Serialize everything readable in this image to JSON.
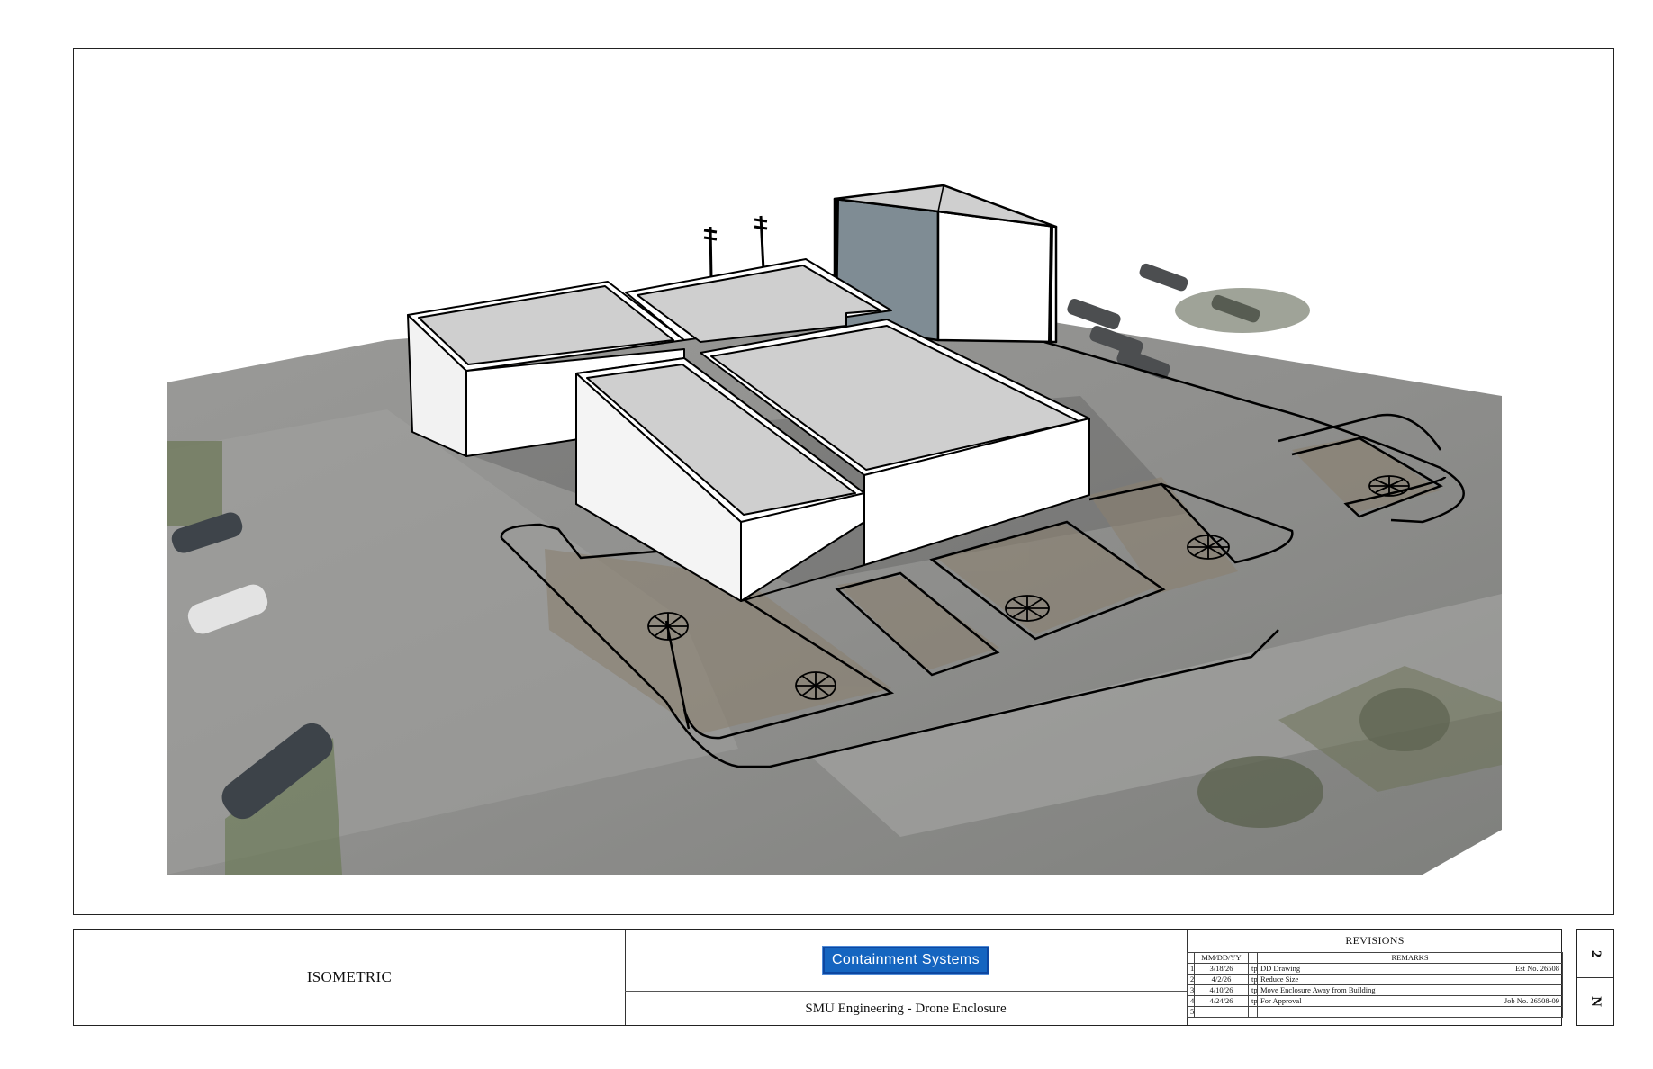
{
  "title_block": {
    "view_name": "ISOMETRIC",
    "company_logo": "Containment Systems",
    "project_title": "SMU Engineering -  Drone Enclosure"
  },
  "revisions": {
    "title": "REVISIONS",
    "headers": {
      "date": "MM/DD/YY",
      "remarks": "REMARKS"
    },
    "rows": [
      {
        "num": "1",
        "date": "3/18/26",
        "by": "tp",
        "remark": "DD Drawing",
        "note": "Est No. 26508"
      },
      {
        "num": "2",
        "date": "4/2/26",
        "by": "tp",
        "remark": "Reduce Size",
        "note": ""
      },
      {
        "num": "3",
        "date": "4/10/26",
        "by": "tp",
        "remark": "Move Enclosure Away from Building",
        "note": ""
      },
      {
        "num": "4",
        "date": "4/24/26",
        "by": "tp",
        "remark": "For Approval",
        "note": "Job No. 26508-09"
      },
      {
        "num": "5",
        "date": "",
        "by": "",
        "remark": "",
        "note": ""
      }
    ]
  },
  "sheet": {
    "number": "2",
    "prefix": "N"
  },
  "colors": {
    "logo_blue": "#1565c0",
    "site_gray": "#8d8d8c",
    "roof_gray": "#cfcfcf",
    "enclosure_side": "#7f8c94"
  }
}
